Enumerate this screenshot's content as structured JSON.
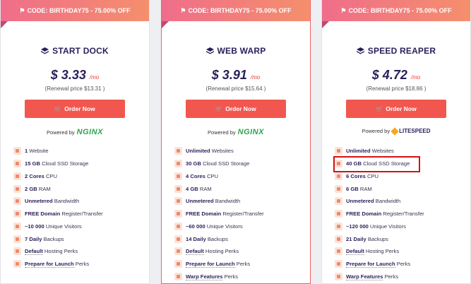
{
  "cards": [
    {
      "banner": "CODE: BIRTHDAY75 - 75.00% OFF",
      "title": "START DOCK",
      "price": "$ 3.33",
      "per": "/mo",
      "renewal": "(Renewal price $13.31 )",
      "order_label": "Order Now",
      "powered_by": "Powered by",
      "server_logo": "NGINX",
      "features": [
        {
          "bold": "1",
          "text": " Website",
          "icon": "globe-icon"
        },
        {
          "bold": "15 GB",
          "text": " Cloud SSD Storage",
          "icon": "storage-icon"
        },
        {
          "bold": "2 Cores",
          "text": " CPU",
          "icon": "cpu-icon"
        },
        {
          "bold": "2 GB",
          "text": " RAM",
          "icon": "ram-icon"
        },
        {
          "bold": "Unmetered",
          "text": " Bandwidth",
          "icon": "bandwidth-icon"
        },
        {
          "bold": "FREE Domain",
          "text": " Register/Transfer",
          "icon": "domain-icon"
        },
        {
          "bold": "~10 000",
          "text": " Unique Visitors",
          "icon": "visitors-icon"
        },
        {
          "bold": "7 Daily",
          "text": " Backups",
          "icon": "backup-icon"
        },
        {
          "bold": "Default",
          "text": " Hosting Perks",
          "icon": "perks-icon"
        },
        {
          "bold": "Prepare for Launch",
          "text": " Perks",
          "icon": "launch-icon"
        }
      ]
    },
    {
      "banner": "CODE: BIRTHDAY75 - 75.00% OFF",
      "title": "WEB WARP",
      "price": "$ 3.91",
      "per": "/mo",
      "renewal": "(Renewal price $15.64 )",
      "order_label": "Order Now",
      "powered_by": "Powered by",
      "server_logo": "NGINX",
      "features": [
        {
          "bold": "Unlimited",
          "text": " Websites",
          "icon": "globe-icon"
        },
        {
          "bold": "30 GB",
          "text": " Cloud SSD Storage",
          "icon": "storage-icon"
        },
        {
          "bold": "4 Cores",
          "text": " CPU",
          "icon": "cpu-icon"
        },
        {
          "bold": "4 GB",
          "text": " RAM",
          "icon": "ram-icon"
        },
        {
          "bold": "Unmetered",
          "text": " Bandwidth",
          "icon": "bandwidth-icon"
        },
        {
          "bold": "FREE Domain",
          "text": " Register/Transfer",
          "icon": "domain-icon"
        },
        {
          "bold": "~60 000",
          "text": " Unique Visitors",
          "icon": "visitors-icon"
        },
        {
          "bold": "14 Daily",
          "text": " Backups",
          "icon": "backup-icon"
        },
        {
          "bold": "Default",
          "text": " Hosting Perks",
          "icon": "perks-icon"
        },
        {
          "bold": "Prepare for Launch",
          "text": " Perks",
          "icon": "launch-icon"
        },
        {
          "bold": "Warp Features",
          "text": " Perks",
          "icon": "warp-icon"
        }
      ]
    },
    {
      "banner": "CODE: BIRTHDAY75 - 75.00% OFF",
      "title": "SPEED REAPER",
      "price": "$ 4.72",
      "per": "/mo",
      "renewal": "(Renewal price $18.86 )",
      "order_label": "Order Now",
      "powered_by": "Powered by",
      "server_logo": "LITESPEED",
      "features": [
        {
          "bold": "Unlimited",
          "text": " Websites",
          "icon": "globe-icon"
        },
        {
          "bold": "40 GB",
          "text": " Cloud SSD Storage",
          "icon": "storage-icon"
        },
        {
          "bold": "6 Cores",
          "text": " CPU",
          "icon": "cpu-icon"
        },
        {
          "bold": "6 GB",
          "text": " RAM",
          "icon": "ram-icon"
        },
        {
          "bold": "Unmetered",
          "text": " Bandwidth",
          "icon": "bandwidth-icon"
        },
        {
          "bold": "FREE Domain",
          "text": " Register/Transfer",
          "icon": "domain-icon"
        },
        {
          "bold": "~120 000",
          "text": " Unique Visitors",
          "icon": "visitors-icon"
        },
        {
          "bold": "21 Daily",
          "text": " Backups",
          "icon": "backup-icon"
        },
        {
          "bold": "Default",
          "text": " Hosting Perks",
          "icon": "perks-icon"
        },
        {
          "bold": "Prepare for Launch",
          "text": " Perks",
          "icon": "launch-icon"
        },
        {
          "bold": "Warp Features",
          "text": " Perks",
          "icon": "warp-icon"
        }
      ]
    }
  ],
  "colors": {
    "banner_start": "#ef6d8b",
    "banner_end": "#f58f6c",
    "order_button": "#f2574f",
    "title": "#2a1f5a",
    "nginx": "#2da44e",
    "highlight": "#d01414"
  }
}
